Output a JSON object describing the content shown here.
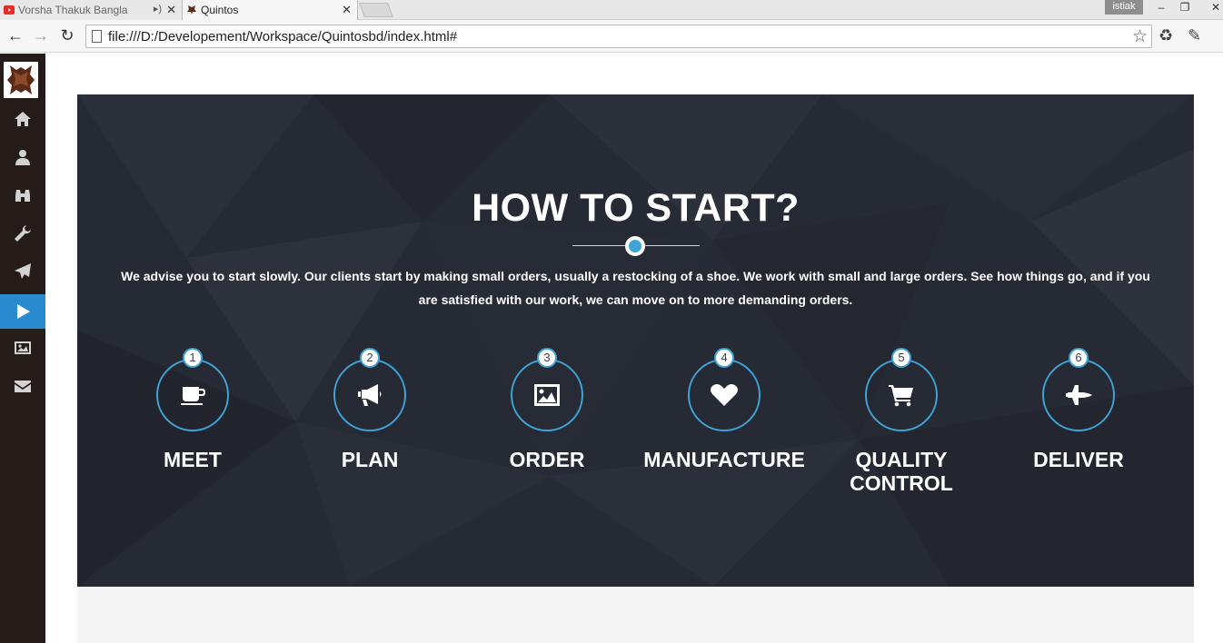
{
  "browser": {
    "tabs": [
      {
        "title": "Vorsha Thakuk Bangla",
        "active": false,
        "audio": true
      },
      {
        "title": "Quintos",
        "active": true,
        "audio": false
      }
    ],
    "profile_name": "istiak",
    "url": "file:///D:/Developement/Workspace/Quintosbd/index.html#"
  },
  "sidenav": {
    "items": [
      {
        "icon": "home-icon",
        "active": false
      },
      {
        "icon": "user-icon",
        "active": false
      },
      {
        "icon": "binoculars-icon",
        "active": false
      },
      {
        "icon": "wrench-icon",
        "active": false
      },
      {
        "icon": "paper-plane-icon",
        "active": false
      },
      {
        "icon": "play-icon",
        "active": true
      },
      {
        "icon": "image-icon",
        "active": false
      },
      {
        "icon": "envelope-icon",
        "active": false
      }
    ]
  },
  "hero": {
    "title": "HOW TO START?",
    "description": "We advise you to start slowly. Our clients start by making small orders, usually a restocking of a shoe. We work with small and large orders. See how things go, and if you are satisfied with our work, we can move on to more demanding orders.",
    "steps": [
      {
        "number": "1",
        "label": "MEET",
        "icon": "coffee-icon"
      },
      {
        "number": "2",
        "label": "PLAN",
        "icon": "bullhorn-icon"
      },
      {
        "number": "3",
        "label": "ORDER",
        "icon": "picture-icon"
      },
      {
        "number": "4",
        "label": "MANUFACTURE",
        "icon": "heart-icon"
      },
      {
        "number": "5",
        "label": "QUALITY CONTROL",
        "icon": "cart-icon"
      },
      {
        "number": "6",
        "label": "DELIVER",
        "icon": "space-shuttle-icon"
      }
    ]
  },
  "colors": {
    "accent": "#3fa3d5",
    "hero_bg": "#262a35",
    "sidenav_bg": "#251c19",
    "sidenav_active": "#2a8ad0"
  }
}
